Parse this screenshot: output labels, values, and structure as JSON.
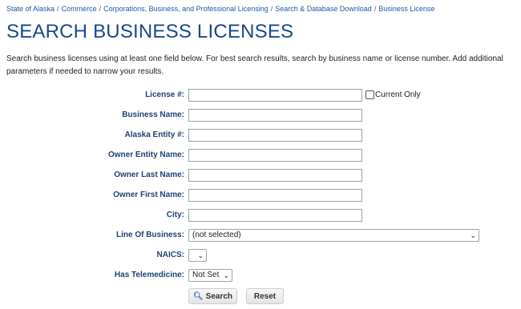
{
  "breadcrumb": [
    {
      "label": "State of Alaska"
    },
    {
      "label": "Commerce"
    },
    {
      "label": "Corporations, Business, and Professional Licensing"
    },
    {
      "label": "Search & Database Download"
    },
    {
      "label": "Business License"
    }
  ],
  "breadcrumb_separator": "/",
  "page_title": "SEARCH BUSINESS LICENSES",
  "intro": "Search business licenses using at least one field below. For best search results, search by business name or license number. Add additional parameters if needed to narrow your results.",
  "form": {
    "license_label": "License #:",
    "license_value": "",
    "current_only_label": "Current Only",
    "current_only_checked": false,
    "business_name_label": "Business Name:",
    "business_name_value": "",
    "entity_label": "Alaska Entity #:",
    "entity_value": "",
    "owner_entity_label": "Owner Entity Name:",
    "owner_entity_value": "",
    "owner_last_label": "Owner Last Name:",
    "owner_last_value": "",
    "owner_first_label": "Owner First Name:",
    "owner_first_value": "",
    "city_label": "City:",
    "city_value": "",
    "line_of_business_label": "Line Of Business:",
    "line_of_business_value": "(not selected)",
    "naics_label": "NAICS:",
    "naics_value": "",
    "telemedicine_label": "Has Telemedicine:",
    "telemedicine_value": "Not Set"
  },
  "buttons": {
    "search_label": "Search",
    "search_icon": "magnifier-icon",
    "reset_label": "Reset"
  },
  "colors": {
    "title": "#164a8a",
    "label": "#1f3f73",
    "link": "#1a5aa6"
  }
}
